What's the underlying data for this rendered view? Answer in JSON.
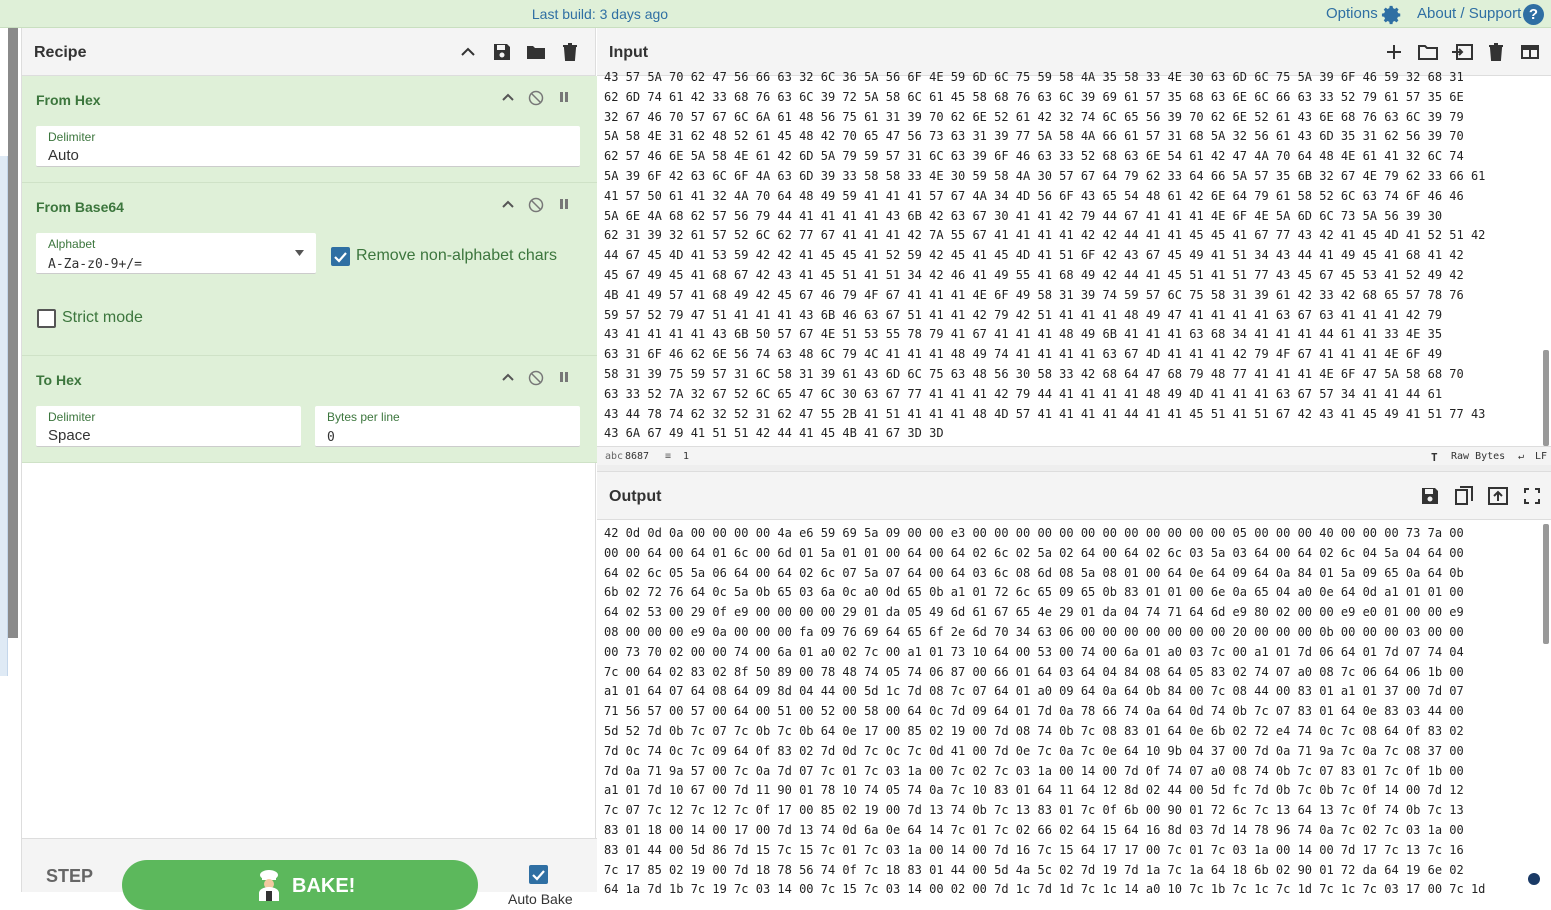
{
  "topbar": {
    "build": "Last build: 3 days ago",
    "options": "Options",
    "about": "About / Support",
    "help": "?"
  },
  "recipe": {
    "title": "Recipe",
    "ops": [
      {
        "name": "From Hex",
        "delimiter_label": "Delimiter",
        "delimiter_value": "Auto"
      },
      {
        "name": "From Base64",
        "alphabet_label": "Alphabet",
        "alphabet_value": "A-Za-z0-9+/=",
        "remove_label": "Remove non-alphabet chars",
        "strict_label": "Strict mode"
      },
      {
        "name": "To Hex",
        "delimiter_label": "Delimiter",
        "delimiter_value": "Space",
        "bpl_label": "Bytes per line",
        "bpl_value": "0"
      }
    ],
    "step": "STEP",
    "bake": "BAKE!",
    "autobake": "Auto Bake"
  },
  "input": {
    "title": "Input",
    "lines": [
      "43 57 5A 70 62 47 56 66 63 32 6C 36 5A 56 6F 4E 59 6D 6C 75 59 58 4A 35 58 33 4E 30 63 6D 6C 75 5A 39 6F 46 59 32 68 31",
      "62 6D 74 61 42 33 68 76 63 6C 39 72 5A 58 6C 61 45 58 68 76 63 6C 39 69 61 57 35 68 63 6E 6C 66 63 33 52 79 61 57 35 6E",
      "32 67 46 70 57 67 6C 6A 61 48 56 75 61 31 39 70 62 6E 52 61 42 32 74 6C 65 56 39 70 62 6E 52 61 43 6E 68 76 63 6C 39 79",
      "5A 58 4E 31 62 48 52 61 45 48 42 70 65 47 56 73 63 31 39 77 5A 58 4A 66 61 57 31 68 5A 32 56 61 43 6D 35 31 62 56 39 70",
      "62 57 46 6E 5A 58 4E 61 42 6D 5A 79 59 57 31 6C 63 39 6F 46 63 33 52 68 63 6E 54 61 42 47 4A 70 64 48 4E 61 41 32 6C 74",
      "5A 39 6F 42 63 6C 6F 4A 63 6D 39 33 58 58 33 4E 30 59 58 4A 30 57 67 64 79 62 33 64 66 5A 57 35 6B 32 67 4E 79 62 33 66 61",
      "41 57 50 61 41 32 4A 70 64 48 49 59 41 41 41 57 67 4A 34 4D 56 6F 43 65 54 48 61 42 6E 64 79 61 58 52 6C 63 74 6F 46 46",
      "5A 6E 4A 68 62 57 56 79 44 41 41 41 41 43 6B 42 63 67 30 41 41 42 79 44 67 41 41 41 4E 6F 4E 5A 6D 6C 73 5A 56 39 30",
      "62 31 39 32 61 57 52 6C 62 77 67 41 41 41 42 7A 55 67 41 41 41 41 42 42 44 41 41 45 45 41 67 77 43 42 41 45 4D 41 52 51 42",
      "44 67 45 4D 41 53 59 42 42 41 45 45 41 52 59 42 45 41 45 4D 41 51 6F 42 43 67 45 49 41 51 34 43 44 41 49 45 41 68 41 42",
      "45 67 49 45 41 68 67 42 43 41 45 51 41 51 34 42 46 41 49 55 41 68 49 42 44 41 45 51 41 51 77 43 45 67 45 53 41 52 49 42",
      "4B 41 49 57 41 68 49 42 45 67 46 79 4F 67 41 41 41 4E 6F 49 58 31 39 74 59 57 6C 75 58 31 39 61 42 33 42 68 65 57 78 76",
      "59 57 52 79 47 51 41 41 41 43 6B 46 63 67 51 41 41 42 79 42 51 41 41 41 48 49 47 41 41 41 41 63 67 63 41 41 41 42 79",
      "43 41 41 41 41 43 6B 50 57 67 4E 51 53 55 78 79 41 67 41 41 41 48 49 6B 41 41 41 63 68 34 41 41 41 44 61 41 33 4E 35",
      "63 31 6F 46 62 6E 56 74 63 48 6C 79 4C 41 41 41 48 49 74 41 41 41 41 63 67 4D 41 41 41 42 79 4F 67 41 41 41 4E 6F 49",
      "58 31 39 75 59 57 31 6C 58 31 39 61 43 6D 6C 75 63 48 56 30 58 33 42 68 64 47 68 79 48 77 41 41 41 4E 6F 47 5A 58 68 70",
      "63 33 52 7A 32 67 52 6C 65 47 6C 30 63 67 77 41 41 41 42 79 44 41 41 41 41 48 49 4D 41 41 41 63 67 57 34 41 41 44 61",
      "43 44 78 74 62 32 52 31 62 47 55 2B 41 51 41 41 41 48 4D 57 41 41 41 41 44 41 41 45 51 41 51 67 42 43 41 45 49 41 51 77 43",
      "43 6A 67 49 41 51 51 42 44 41 45 4B 41 67 3D 3D"
    ],
    "chars": "8687",
    "lines_count": "1",
    "raw_bytes": "Raw Bytes",
    "lf": "LF"
  },
  "output": {
    "title": "Output",
    "lines": [
      "42 0d 0d 0a 00 00 00 00 4a e6 59 69 5a 09 00 00 e3 00 00 00 00 00 00 00 00 00 00 00 00 05 00 00 00 40 00 00 00 73 7a 00",
      "00 00 64 00 64 01 6c 00 6d 01 5a 01 01 00 64 00 64 02 6c 02 5a 02 64 00 64 02 6c 03 5a 03 64 00 64 02 6c 04 5a 04 64 00",
      "64 02 6c 05 5a 06 64 00 64 02 6c 07 5a 07 64 00 64 03 6c 08 6d 08 5a 08 01 00 64 0e 64 09 64 0a 84 01 5a 09 65 0a 64 0b",
      "6b 02 72 76 64 0c 5a 0b 65 03 6a 0c a0 0d 65 0b a1 01 72 6c 65 09 65 0b 83 01 01 00 6e 0a 65 04 a0 0e 64 0d a1 01 01 00",
      "64 02 53 00 29 0f e9 00 00 00 00 29 01 da 05 49 6d 61 67 65 4e 29 01 da 04 74 71 64 6d e9 80 02 00 00 e9 e0 01 00 00 e9",
      "08 00 00 00 e9 0a 00 00 00 fa 09 76 69 64 65 6f 2e 6d 70 34 63 06 00 00 00 00 00 00 00 20 00 00 00 0b 00 00 00 03 00 00",
      "00 73 70 02 00 00 74 00 6a 01 a0 02 7c 00 a1 01 73 10 64 00 53 00 74 00 6a 01 a0 03 7c 00 a1 01 7d 06 64 01 7d 07 74 04",
      "7c 00 64 02 83 02 8f 50 89 00 78 48 74 05 74 06 87 00 66 01 64 03 64 04 84 08 64 05 83 02 74 07 a0 08 7c 06 64 06 1b 00",
      "a1 01 64 07 64 08 64 09 8d 04 44 00 5d 1c 7d 08 7c 07 64 01 a0 09 64 0a 64 0b 84 00 7c 08 44 00 83 01 a1 01 37 00 7d 07",
      "71 56 57 00 57 00 64 00 51 00 52 00 58 00 64 0c 7d 09 64 01 7d 0a 78 66 74 0a 64 0d 74 0b 7c 07 83 01 64 0e 83 03 44 00",
      "5d 52 7d 0b 7c 07 7c 0b 7c 0b 64 0e 17 00 85 02 19 00 7d 08 74 0b 7c 08 83 01 64 0e 6b 02 72 e4 74 0c 7c 08 64 0f 83 02",
      "7d 0c 74 0c 7c 09 64 0f 83 02 7d 0d 7c 0c 7c 0d 41 00 7d 0e 7c 0a 7c 0e 64 10 9b 04 37 00 7d 0a 71 9a 7c 0a 7c 08 37 00",
      "7d 0a 71 9a 57 00 7c 0a 7d 07 7c 01 7c 03 1a 00 7c 02 7c 03 1a 00 14 00 7d 0f 74 07 a0 08 74 0b 7c 07 83 01 7c 0f 1b 00",
      "a1 01 7d 10 67 00 7d 11 90 01 78 10 74 05 74 0a 7c 10 83 01 64 11 64 12 8d 02 44 00 5d fc 7d 0b 7c 0b 7c 0f 14 00 7d 12",
      "7c 07 7c 12 7c 12 7c 0f 17 00 85 02 19 00 7d 13 74 0b 7c 13 83 01 7c 0f 6b 00 90 01 72 6c 7c 13 64 13 7c 0f 74 0b 7c 13",
      "83 01 18 00 14 00 17 00 7d 13 74 0d 6a 0e 64 14 7c 01 7c 02 66 02 64 15 64 16 8d 03 7d 14 78 96 74 0a 7c 02 7c 03 1a 00",
      "83 01 44 00 5d 86 7d 15 7c 15 7c 01 7c 03 1a 00 14 00 7d 16 7c 15 64 17 17 00 7c 01 7c 03 1a 00 14 00 7d 17 7c 13 7c 16",
      "7c 17 85 02 19 00 7d 18 78 56 74 0f 7c 18 83 01 44 00 5d 4a 5c 02 7d 19 7d 1a 7c 1a 64 18 6b 02 90 01 72 da 64 19 6e 02",
      "64 1a 7d 1b 7c 19 7c 03 14 00 7c 15 7c 03 14 00 02 00 7d 1c 7d 1d 7c 1c 14 a0 10 7c 1b 7c 1c 7c 1d 7c 1c 7c 03 17 00 7c 1d"
    ]
  }
}
